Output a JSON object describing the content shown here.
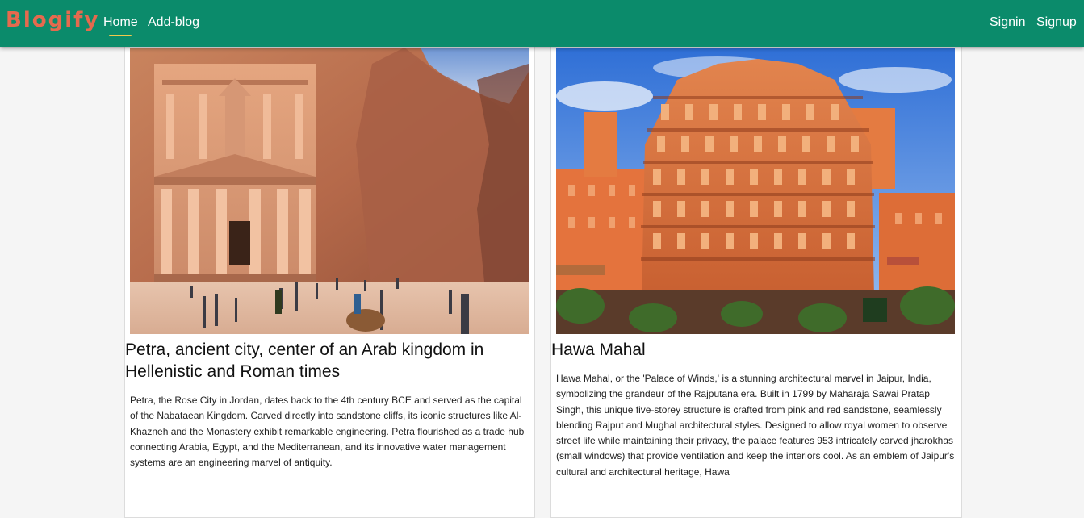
{
  "navbar": {
    "brand": "Blogify",
    "links": [
      {
        "label": "Home",
        "active": true
      },
      {
        "label": "Add-blog",
        "active": false
      }
    ],
    "auth": [
      {
        "label": "Signin"
      },
      {
        "label": "Signup"
      }
    ],
    "colors": {
      "background": "#0b8b6b",
      "brand": "#e56a4e",
      "active_underline": "#f2c94c"
    }
  },
  "blogs": [
    {
      "image": "petra-treasury-photo",
      "title": "Petra, ancient city, center of an Arab kingdom in Hellenistic and Roman times",
      "body": "Petra, the Rose City in Jordan, dates back to the 4th century BCE and served as the capital of the Nabataean Kingdom. Carved directly into sandstone cliffs, its iconic structures like Al-Khazneh and the Monastery exhibit remarkable engineering. Petra flourished as a trade hub connecting Arabia, Egypt, and the Mediterranean, and its innovative water management systems are an engineering marvel of antiquity."
    },
    {
      "image": "hawa-mahal-photo",
      "title": "Hawa Mahal",
      "body": "Hawa Mahal, or the 'Palace of Winds,' is a stunning architectural marvel in Jaipur, India, symbolizing the grandeur of the Rajputana era. Built in 1799 by Maharaja Sawai Pratap Singh, this unique five-storey structure is crafted from pink and red sandstone, seamlessly blending Rajput and Mughal architectural styles. Designed to allow royal women to observe street life while maintaining their privacy, the palace features 953 intricately carved jharokhas (small windows) that provide ventilation and keep the interiors cool. As an emblem of Jaipur's cultural and architectural heritage, Hawa"
    }
  ]
}
